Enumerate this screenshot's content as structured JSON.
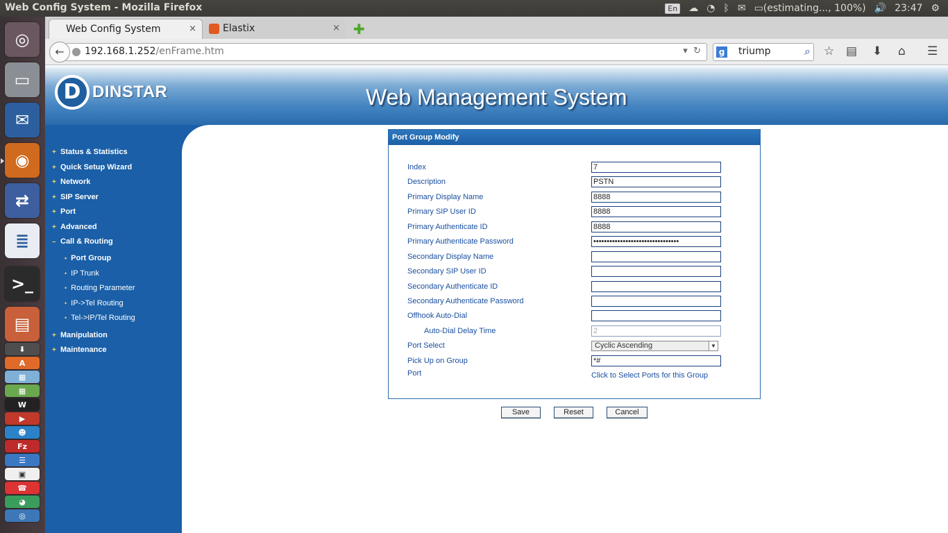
{
  "window_title": "Web Config System - Mozilla Firefox",
  "indicators": {
    "keyboard": "En",
    "battery_text": "(estimating..., 100%)",
    "clock": "23:47"
  },
  "tabs": [
    {
      "label": "Web Config System",
      "close": "×"
    },
    {
      "label": "Elastix",
      "close": "×"
    }
  ],
  "url": {
    "host": "192.168.1.252",
    "path": "/enFrame.htm"
  },
  "search": {
    "engine": "g",
    "value": "triump"
  },
  "header": {
    "logo_text": "DINSTAR",
    "title": "Web Management System"
  },
  "menu": [
    {
      "marker": "+",
      "label": "Status & Statistics"
    },
    {
      "marker": "+",
      "label": "Quick Setup Wizard"
    },
    {
      "marker": "+",
      "label": "Network"
    },
    {
      "marker": "+",
      "label": "SIP Server"
    },
    {
      "marker": "+",
      "label": "Port"
    },
    {
      "marker": "+",
      "label": "Advanced"
    },
    {
      "marker": "–",
      "label": "Call & Routing"
    },
    {
      "marker": "+",
      "label": "Manipulation"
    },
    {
      "marker": "+",
      "label": "Maintenance"
    }
  ],
  "submenu": [
    {
      "label": "Port Group"
    },
    {
      "label": "IP Trunk"
    },
    {
      "label": "Routing Parameter"
    },
    {
      "label": "IP->Tel Routing"
    },
    {
      "label": "Tel->IP/Tel Routing"
    }
  ],
  "form": {
    "heading": "Port Group Modify",
    "fields": [
      {
        "label": "Index",
        "value": "7"
      },
      {
        "label": "Description",
        "value": "PSTN"
      },
      {
        "label": "Primary Display Name",
        "value": "8888"
      },
      {
        "label": "Primary SIP User ID",
        "value": "8888"
      },
      {
        "label": "Primary Authenticate ID",
        "value": "8888"
      },
      {
        "label": "Primary Authenticate Password",
        "value": "••••••••••••••••••••••••••••••••"
      },
      {
        "label": "Secondary Display Name",
        "value": ""
      },
      {
        "label": "Secondary SIP User ID",
        "value": ""
      },
      {
        "label": "Secondary Authenticate ID",
        "value": ""
      },
      {
        "label": "Secondary Authenticate Password",
        "value": ""
      },
      {
        "label": "Offhook Auto-Dial",
        "value": ""
      },
      {
        "label": "Auto-Dial Delay Time",
        "value": "2"
      }
    ],
    "port_select_label": "Port Select",
    "port_select_value": "Cyclic Ascending",
    "pickup_label": "Pick Up on Group",
    "pickup_value": "*#",
    "port_label": "Port",
    "port_link": "Click to Select Ports for this Group"
  },
  "buttons": {
    "save": "Save",
    "reset": "Reset",
    "cancel": "Cancel"
  },
  "colors": {
    "accent": "#1a5fa7",
    "label": "#1a4fa0",
    "menu_marker": "#f5d76e"
  }
}
